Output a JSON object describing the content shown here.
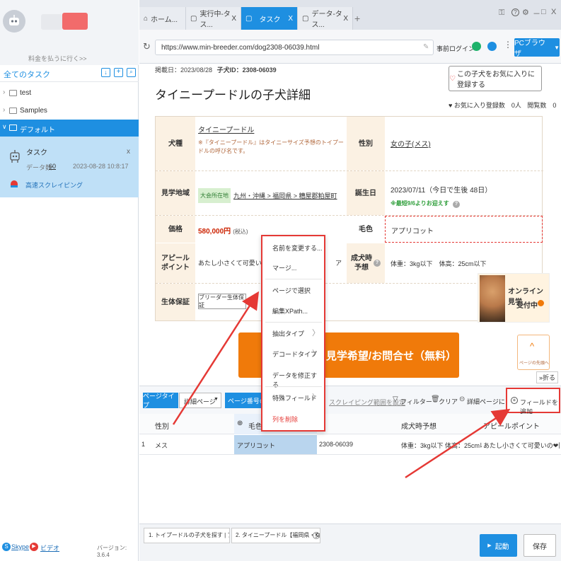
{
  "sidebar": {
    "pay_link": "料金を払うに行く>>",
    "all_tasks": "全てのタスク",
    "folders": [
      {
        "label": "test"
      },
      {
        "label": "Samples"
      },
      {
        "label": "デフォルト"
      }
    ],
    "task": {
      "name": "タスク",
      "data_count_label": "データ数:",
      "data_count": "60",
      "date": "2023-08-28 10:8:17",
      "mode": "高速スクレイピング"
    },
    "footer": {
      "skype": "Skype",
      "video": "ビデオ",
      "version": "バージョン: 3.6.4"
    }
  },
  "tabs": [
    {
      "label": "ホーム..."
    },
    {
      "label": "実行中-タス..."
    },
    {
      "label": "タスク"
    },
    {
      "label": "データ-タス..."
    }
  ],
  "window_controls": {
    "help": "?",
    "minimize": "－",
    "maximize": "□",
    "close": "X"
  },
  "urlbar": {
    "url": "https://www.min-breeder.com/dog2308-06039.html",
    "login": "事前ログイン",
    "browser": "PCブラウザ"
  },
  "page": {
    "meta_date_label": "掲載日：",
    "meta_date": "2023/08/28",
    "meta_id_label": "子犬ID：",
    "meta_id": "2308-06039",
    "favorite_button": "この子犬をお気に入りに登録する",
    "title": "タイニープードルの子犬詳細",
    "favorites_count": "お気に入り登録数　0人",
    "views_count": "閲覧数　0",
    "rows": {
      "breed_label": "犬種",
      "breed_value": "タイニープードル",
      "breed_note": "※『タイニープードル』はタイニーサイズ予想のトイプードルの呼び名です。",
      "sex_label": "性別",
      "sex_value": "女の子(メス)",
      "area_label": "見学地域",
      "area_badge": "大会所在地",
      "area_value": "九州・沖縄 > 福岡県 > 糟屋郡粕屋町",
      "birth_label": "誕生日",
      "birth_value": "2023/07/11（今日で生後 48日）",
      "birth_note": "※最短9/6よりお迎えす",
      "price_label": "価格",
      "price_value": "580,000円",
      "price_tax": "(税込)",
      "color_label": "毛色",
      "color_value": "アプリコット",
      "appeal_label": "アピールポイント",
      "appeal_value": "あたし小さくて可愛いの",
      "appeal_tail": "ア",
      "growth_label": "成犬時予想",
      "growth_value": "体重：3kg以下　体高：25cm以下",
      "guarantee_label": "生体保証",
      "guarantee_button": "ブリーダー生体保証"
    },
    "online_tour": {
      "line1": "オンライン見学",
      "line2": "受付中"
    },
    "cta": "見学希望/お問合せ（無料）",
    "page_top": "ページの先頭へ"
  },
  "context_menu": {
    "items": [
      "名前を変更する...",
      "マージ...",
      "ページで選択",
      "編集XPath...",
      "抽出タイプ",
      "デコードタイプ",
      "データを修正する...",
      "特殊フィールド",
      "列を削除"
    ]
  },
  "toolbar": {
    "collapse": "折る",
    "page_type": "ページタイプ",
    "page_type_value": "詳細ページ",
    "page_number": "ページ番号の設定",
    "scrape_range": "スクレイピング範囲を設定",
    "filter": "フィルター",
    "clear": "クリア",
    "detail_link": "詳細ページに行く",
    "add_field": "フィールドを追加"
  },
  "table": {
    "headers": [
      "性別",
      "毛色",
      "",
      "成犬時予想",
      "アピールポイント"
    ],
    "rows": [
      {
        "num": "1",
        "cells": [
          "メス",
          "アプリコット",
          "2308-06039",
          "体重：3kg以下 体高：25cm以下",
          "あたし小さくて可愛いの❤同腹..."
        ]
      }
    ]
  },
  "bottom": {
    "steps": [
      "1. トイプードルの子犬を探す | ブ...",
      "2. タイニープードル【福岡県・女..."
    ],
    "start": "起動",
    "save": "保存"
  },
  "colors": {
    "accent": "#1e8fe1",
    "orange": "#f07a0a",
    "red": "#e53935",
    "price": "#cc2200"
  }
}
